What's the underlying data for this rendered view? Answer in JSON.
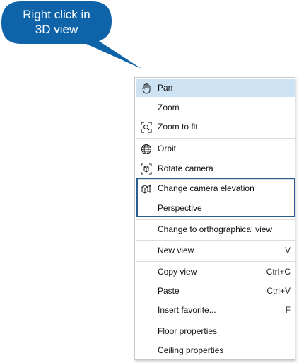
{
  "callout": {
    "line1": "Right click in",
    "line2": "3D view",
    "color": "#0e63a9"
  },
  "menu": {
    "highlight_color": "#cde3f4",
    "group_border_color": "#2a5e92",
    "items": [
      {
        "label": "Pan",
        "icon": "hand-icon"
      },
      {
        "label": "Zoom"
      },
      {
        "label": "Zoom to fit",
        "icon": "zoom-fit-icon"
      },
      {
        "label": "Orbit",
        "icon": "globe-icon"
      },
      {
        "label": "Rotate camera",
        "icon": "rotate-camera-icon"
      },
      {
        "label": "Change camera elevation",
        "icon": "camera-elevation-icon"
      },
      {
        "label": "Perspective"
      },
      {
        "label": "Change to orthographical view"
      },
      {
        "label": "New view",
        "shortcut": "V"
      },
      {
        "label": "Copy view",
        "shortcut": "Ctrl+C"
      },
      {
        "label": "Paste",
        "shortcut": "Ctrl+V"
      },
      {
        "label": "Insert favorite...",
        "shortcut": "F"
      },
      {
        "label": "Floor properties"
      },
      {
        "label": "Ceiling properties"
      }
    ]
  }
}
